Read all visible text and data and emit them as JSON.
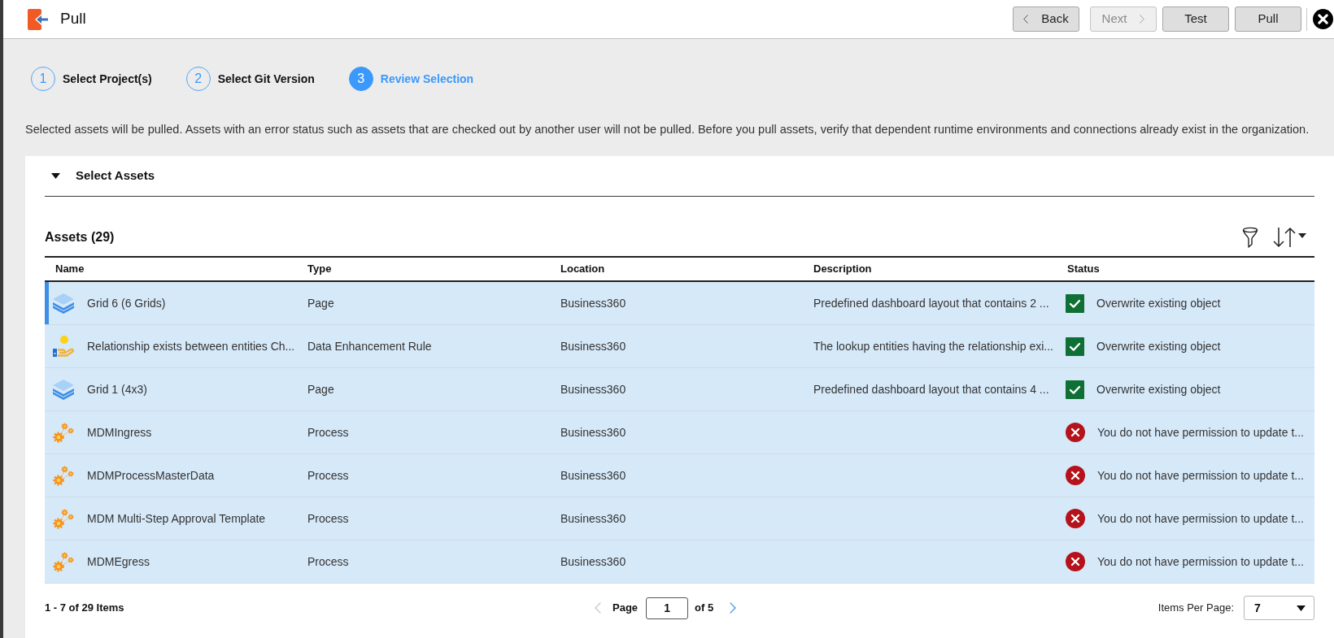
{
  "header": {
    "title": "Pull",
    "buttons": [
      {
        "label": "Back",
        "kind": "prev",
        "disabled": false
      },
      {
        "label": "Next",
        "kind": "next",
        "disabled": true
      },
      {
        "label": "Test",
        "kind": "action",
        "disabled": false
      },
      {
        "label": "Pull",
        "kind": "action",
        "disabled": false
      }
    ]
  },
  "steps": [
    {
      "number": "1",
      "label": "Select Project(s)",
      "selected": false
    },
    {
      "number": "2",
      "label": "Select Git Version",
      "selected": false
    },
    {
      "number": "3",
      "label": "Review Selection",
      "selected": true
    }
  ],
  "description": "Selected assets will be pulled. Assets with an error status such as assets that are checked out by another user will not be pulled. Before you pull assets, verify that dependent runtime environments and connections already exist in the organization.",
  "section": {
    "title": "Select Assets",
    "expanded": true
  },
  "assets": {
    "title": "Assets (29)",
    "columns": [
      "Name",
      "Type",
      "Location",
      "Description",
      "Status"
    ],
    "rows": [
      {
        "kind": "page",
        "name": "Grid 6 (6 Grids)",
        "type": "Page",
        "location": "Business360",
        "description": "Predefined dashboard layout that contains 2 ...",
        "status": {
          "kind": "ok",
          "text": "Overwrite existing object"
        },
        "selected": true,
        "focused": true
      },
      {
        "kind": "rule",
        "name": "Relationship exists between entities Ch...",
        "type": "Data Enhancement Rule",
        "location": "Business360",
        "description": "The lookup entities having the relationship exi...",
        "status": {
          "kind": "ok",
          "text": "Overwrite existing object"
        },
        "selected": true,
        "focused": false
      },
      {
        "kind": "page",
        "name": "Grid 1 (4x3)",
        "type": "Page",
        "location": "Business360",
        "description": "Predefined dashboard layout that contains 4 ...",
        "status": {
          "kind": "ok",
          "text": "Overwrite existing object"
        },
        "selected": true,
        "focused": false
      },
      {
        "kind": "process",
        "name": "MDMIngress",
        "type": "Process",
        "location": "Business360",
        "status": {
          "kind": "error",
          "text": "You do not have permission to update t..."
        },
        "selected": true,
        "focused": false
      },
      {
        "kind": "process",
        "name": "MDMProcessMasterData",
        "type": "Process",
        "location": "Business360",
        "status": {
          "kind": "error",
          "text": "You do not have permission to update t..."
        },
        "selected": true,
        "focused": false
      },
      {
        "kind": "process",
        "name": "MDM Multi-Step Approval Template",
        "type": "Process",
        "location": "Business360",
        "status": {
          "kind": "error",
          "text": "You do not have permission to update t..."
        },
        "selected": true,
        "focused": false
      },
      {
        "kind": "process",
        "name": "MDMEgress",
        "type": "Process",
        "location": "Business360",
        "status": {
          "kind": "error",
          "text": "You do not have permission to update t..."
        },
        "selected": true,
        "focused": false
      }
    ]
  },
  "footer": {
    "range": "1 - 7 of 29 Items",
    "page_label": "Page",
    "page": "1",
    "page_count": "of 5",
    "prev_disabled": true,
    "next_disabled": false,
    "per_page_label": "Items Per Page:",
    "per_page": "7"
  }
}
